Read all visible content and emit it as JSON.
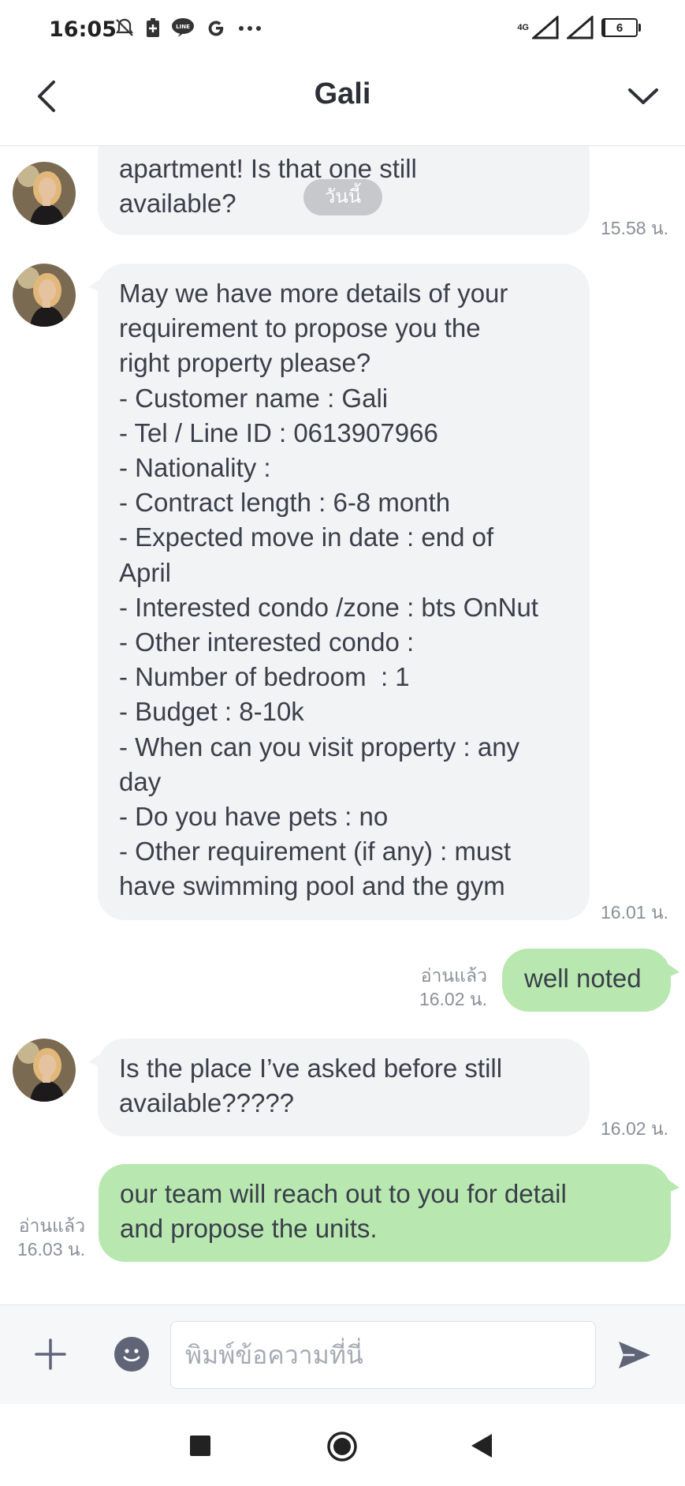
{
  "status_bar": {
    "time": "16:05",
    "network": "4G",
    "battery_level": "6",
    "battery_fraction": 0.06,
    "icons": [
      "mute-icon",
      "battery-saver-icon",
      "line-app-icon",
      "google-icon",
      "more-dots-icon",
      "signal-icon",
      "signal-icon",
      "battery-icon"
    ]
  },
  "header": {
    "title": "Gali"
  },
  "date_separator": "วันนี้",
  "messages": [
    {
      "side": "received",
      "text": "apartment! Is that one still\navailable?",
      "time": "15.58 น."
    },
    {
      "side": "received",
      "text": "May we have more details of your\nrequirement to propose you the\nright property please?\n- Customer name : Gali\n- Tel / Line ID : 0613907966\n- Nationality :\n- Contract length : 6-8 month\n- Expected move in date : end of\nApril\n- Interested condo /zone : bts OnNut\n- Other interested condo :\n- Number of bedroom  : 1\n- Budget : 8-10k\n- When can you visit property : any\nday\n- Do you have pets : no\n- Other requirement (if any) : must\nhave swimming pool and the gym",
      "time": "16.01 น."
    },
    {
      "side": "sent",
      "text": "well noted",
      "read": "อ่านแล้ว",
      "time": "16.02 น."
    },
    {
      "side": "received",
      "text": "Is the place I’ve asked before still\navailable?????",
      "time": "16.02 น."
    },
    {
      "side": "sent",
      "text": "our team will reach out to you for detail\nand propose the units.",
      "read": "อ่านแล้ว",
      "time": "16.03 น."
    }
  ],
  "input": {
    "placeholder": "พิมพ์ข้อความที่นี่"
  },
  "colors": {
    "received_bubble": "#f2f3f5",
    "sent_bubble": "#b8e8b0",
    "text": "#3a3f4a",
    "meta": "#8a8f99"
  }
}
